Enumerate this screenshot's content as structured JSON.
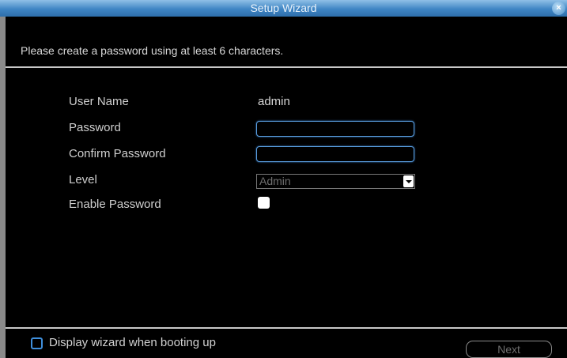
{
  "window": {
    "title": "Setup Wizard",
    "close_glyph": "×"
  },
  "instruction": "Please create a password using at least 6 characters.",
  "form": {
    "username_label": "User Name",
    "username_value": "admin",
    "password_label": "Password",
    "password_value": "",
    "confirm_label": "Confirm Password",
    "confirm_value": "",
    "level_label": "Level",
    "level_value": "Admin",
    "enable_label": "Enable Password",
    "enable_checked": true
  },
  "footer": {
    "display_wizard_label": "Display wizard when booting up",
    "display_wizard_checked": false,
    "next_label": "Next"
  },
  "colors": {
    "titlebar": "#3f85c4",
    "field_border": "#5a9ee0",
    "background": "#000000"
  }
}
